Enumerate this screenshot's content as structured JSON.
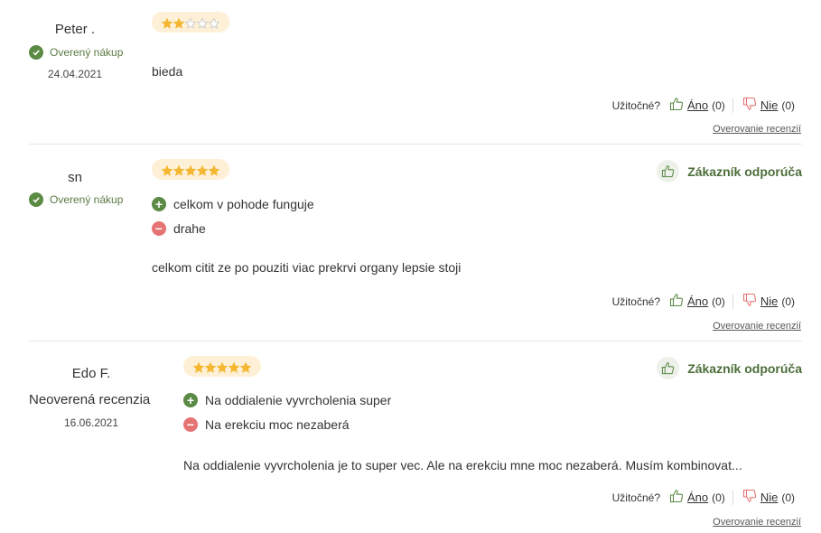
{
  "helpful_label": "Užitočné?",
  "yes_label": "Áno",
  "no_label": "Nie",
  "verify_link": "Overovanie recenzií",
  "recommend_label": "Zákazník odporúča",
  "colors": {
    "green": "#5b8a45",
    "red": "#e57373",
    "star": "#f5b731",
    "star_bg": "#fdf0d6"
  },
  "reviews": [
    {
      "author": "Peter .",
      "verified": "Overený nákup",
      "date": "24.04.2021",
      "rating": 2,
      "text": "bieda",
      "yes_count": "(0)",
      "no_count": "(0)"
    },
    {
      "author": "sn",
      "verified": "Overený nákup",
      "rating": 5,
      "recommend": true,
      "pro": "celkom v pohode funguje",
      "con": "drahe",
      "text": "celkom citit ze po pouziti viac prekrvi organy lepsie stoji",
      "yes_count": "(0)",
      "no_count": "(0)"
    },
    {
      "author": "Edo F.",
      "unverified": "Neoverená recenzia",
      "date": "16.06.2021",
      "rating": 5,
      "recommend": true,
      "pro": "Na oddialenie vyvrcholenia super",
      "con": "Na erekciu moc nezaberá",
      "text": "Na oddialenie vyvrcholenia je to super vec. Ale na erekciu mne moc nezaberá. Musím kombinovat...",
      "yes_count": "(0)",
      "no_count": "(0)"
    }
  ]
}
